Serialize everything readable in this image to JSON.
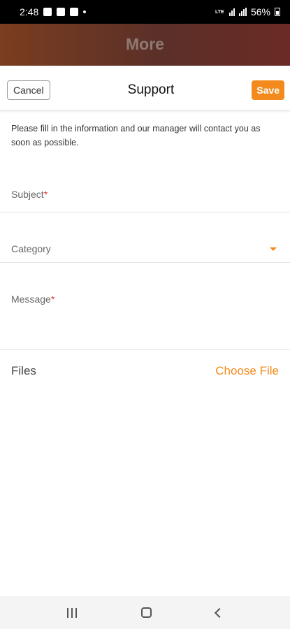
{
  "status_bar": {
    "time": "2:48",
    "network_label": "LTE",
    "battery": "56%"
  },
  "backdrop": {
    "title": "More"
  },
  "sheet": {
    "cancel_label": "Cancel",
    "title": "Support",
    "save_label": "Save",
    "intro": "Please fill in the information and our manager will contact you as soon as possible.",
    "subject_label": "Subject",
    "category_label": "Category",
    "message_label": "Message",
    "required_mark": "*",
    "files_label": "Files",
    "choose_file_label": "Choose File"
  },
  "colors": {
    "accent": "#f28a1c",
    "required": "#e53935"
  },
  "icons": {
    "nav": [
      "recents-icon",
      "home-icon",
      "back-icon"
    ],
    "category": "chevron-down-icon"
  }
}
